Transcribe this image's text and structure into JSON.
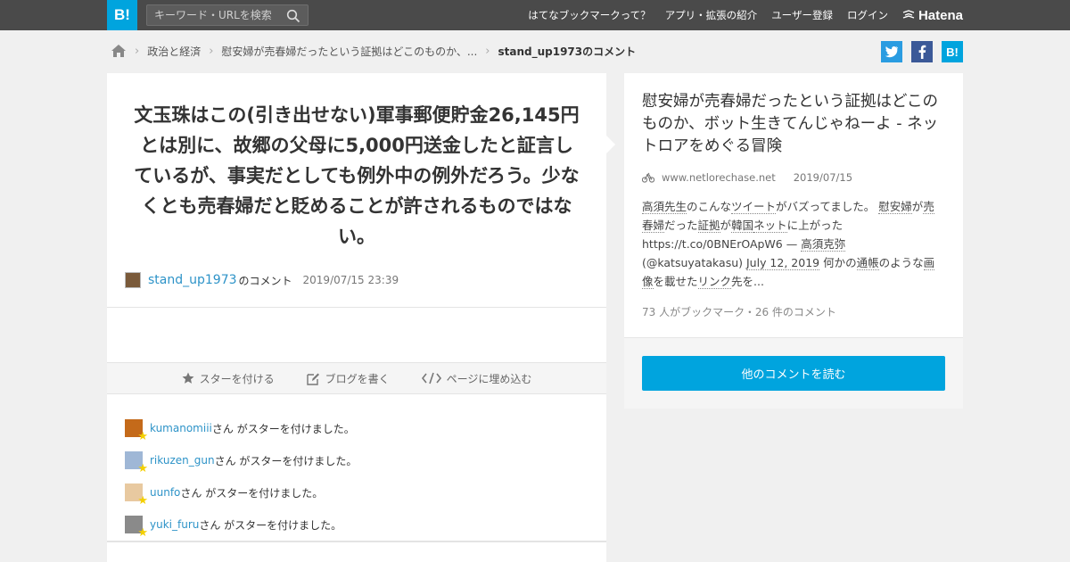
{
  "header": {
    "logo": "B!",
    "search_placeholder": "キーワード・URLを検索",
    "nav": [
      "はてなブックマークって？",
      "アプリ・拡張の紹介",
      "ユーザー登録",
      "ログイン"
    ],
    "brand": "Hatena"
  },
  "breadcrumb": {
    "category": "政治と経済",
    "article": "慰安婦が売春婦だったという証拠はどこのものか、...",
    "current": "stand_up1973のコメント"
  },
  "share": {
    "twitter": "t",
    "facebook": "f",
    "hatena": "B!"
  },
  "comment": {
    "text": "文玉珠はこの(引き出せない)軍事郵便貯金26,145円とは別に、故郷の父母に5,000円送金したと証言しているが、事実だとしても例外中の例外だろう。少なくとも売春婦だと貶めることが許されるものではない。",
    "user": "stand_up1973",
    "user_suffix": "のコメント",
    "date": "2019/07/15 23:39"
  },
  "actions": {
    "star": "スターを付ける",
    "blog": "ブログを書く",
    "embed": "ページに埋め込む"
  },
  "stars": [
    {
      "user": "kumanomiii",
      "text": "さん がスターを付けました。",
      "color": "#c46a1a"
    },
    {
      "user": "rikuzen_gun",
      "text": "さん がスターを付けました。",
      "color": "#9fb7d6"
    },
    {
      "user": "uunfo",
      "text": "さん がスターを付けました。",
      "color": "#e8c9a0"
    },
    {
      "user": "yuki_furu",
      "text": "さん がスターを付けました。",
      "color": "#8a8a8a"
    }
  ],
  "article": {
    "title": "慰安婦が売春婦だったという証拠はどこのものか、ボット生きてんじゃねーよ - ネットロアをめぐる冒険",
    "domain": "www.netlorechase.net",
    "date": "2019/07/15",
    "desc_parts": [
      {
        "t": "高須先生",
        "u": true
      },
      {
        "t": "のこんな",
        "u": false
      },
      {
        "t": "ツイート",
        "u": true
      },
      {
        "t": "がバズってました。 ",
        "u": false
      },
      {
        "t": "慰安婦",
        "u": true
      },
      {
        "t": "が",
        "u": false
      },
      {
        "t": "売春婦",
        "u": true
      },
      {
        "t": "だった",
        "u": false
      },
      {
        "t": "証拠",
        "u": true
      },
      {
        "t": "が",
        "u": false
      },
      {
        "t": "韓国",
        "u": true
      },
      {
        "t": "ネット",
        "u": true
      },
      {
        "t": "に上がった https://t.co/0BNErOApW6 — ",
        "u": false
      },
      {
        "t": "高須克弥",
        "u": true
      },
      {
        "t": " (@katsuyatakasu) ",
        "u": false
      },
      {
        "t": "July 12, 2019",
        "u": true
      },
      {
        "t": " 何かの",
        "u": false
      },
      {
        "t": "通帳",
        "u": true
      },
      {
        "t": "のような",
        "u": false
      },
      {
        "t": "画像",
        "u": true
      },
      {
        "t": "を載せた",
        "u": false
      },
      {
        "t": "リンク",
        "u": true
      },
      {
        "t": "先を...",
        "u": false
      }
    ],
    "count": "73 人がブックマーク・26 件のコメント",
    "read_button": "他のコメントを読む"
  },
  "colors": {
    "accent": "#00a4de",
    "link": "#2d93c8",
    "header_bg": "#4a4a4a"
  }
}
